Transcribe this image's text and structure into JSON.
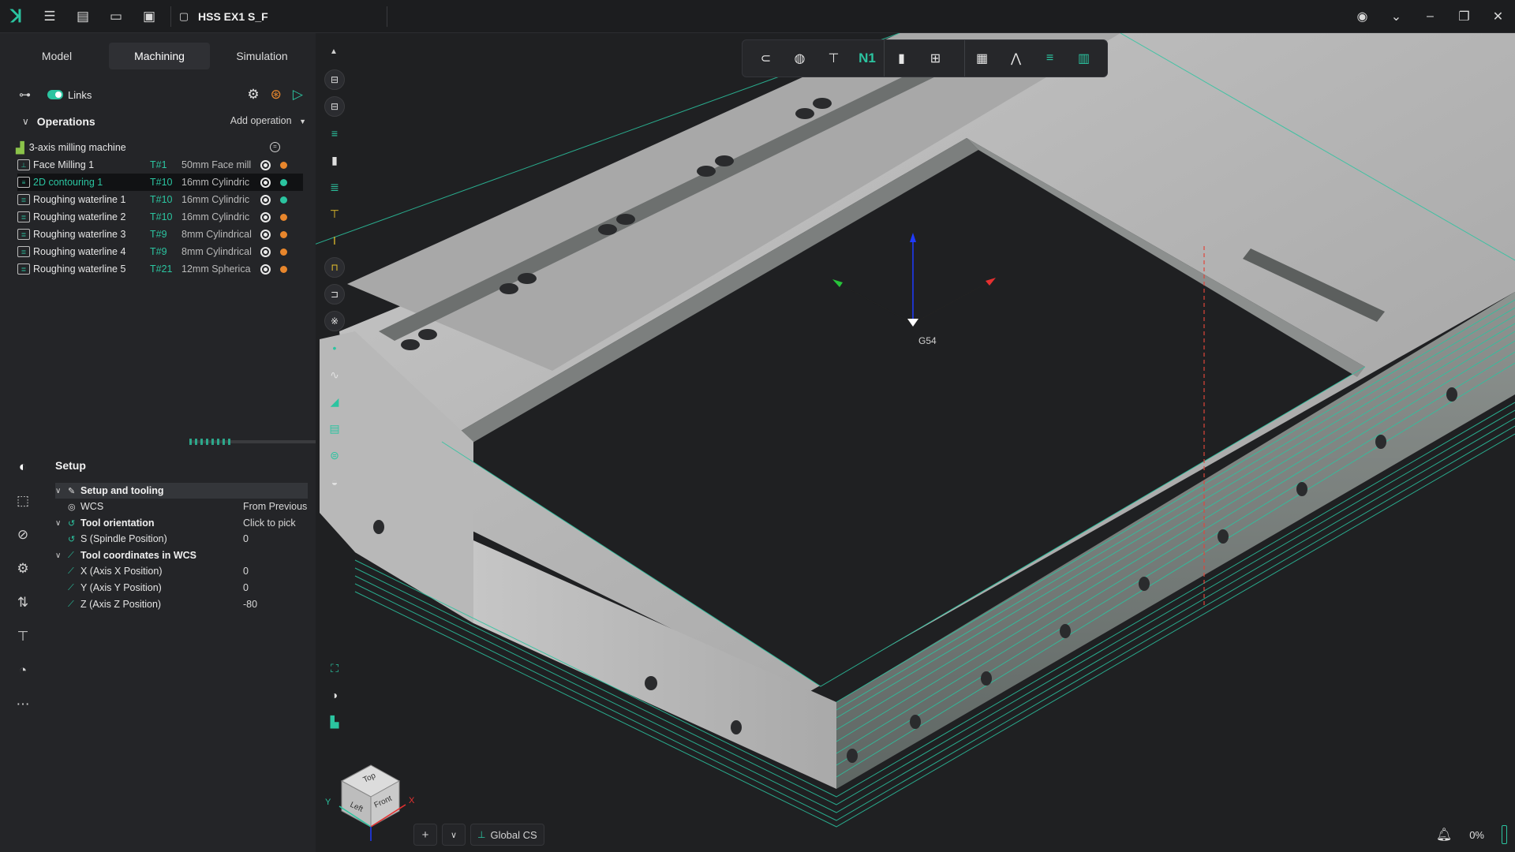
{
  "titlebar": {
    "doc_title": "HSS EX1 S_F",
    "icons": [
      "app-logo-icon",
      "menu-icon",
      "new-file-icon",
      "open-folder-icon",
      "save-icon",
      "document-icon"
    ],
    "right_icons": [
      "user-avatar-icon",
      "chevron-down-icon",
      "minimize-icon",
      "maximize-icon",
      "close-icon"
    ]
  },
  "tabs": [
    {
      "label": "Model"
    },
    {
      "label": "Machining"
    },
    {
      "label": "Simulation"
    }
  ],
  "links": {
    "label": "Links",
    "enabled": true
  },
  "operations": {
    "title": "Operations",
    "add_label": "Add operation",
    "machine": "3-axis milling machine",
    "items": [
      {
        "name": "Face Milling 1",
        "tool": "T#1",
        "desc": "50mm Face mill",
        "status": "#e8862c"
      },
      {
        "name": "2D contouring 1",
        "tool": "T#10",
        "desc": "16mm Cylindric",
        "status": "#2bc4a0"
      },
      {
        "name": "Roughing waterline 1",
        "tool": "T#10",
        "desc": "16mm Cylindric",
        "status": "#2bc4a0"
      },
      {
        "name": "Roughing waterline 2",
        "tool": "T#10",
        "desc": "16mm Cylindric",
        "status": "#e8862c"
      },
      {
        "name": "Roughing waterline 3",
        "tool": "T#9",
        "desc": "8mm Cylindrical",
        "status": "#e8862c"
      },
      {
        "name": "Roughing waterline 4",
        "tool": "T#9",
        "desc": "8mm Cylindrical",
        "status": "#e8862c"
      },
      {
        "name": "Roughing waterline 5",
        "tool": "T#21",
        "desc": "12mm Spherica",
        "status": "#e8862c"
      }
    ],
    "selected_index": 1
  },
  "setup": {
    "title": "Setup",
    "group1": "Setup and tooling",
    "wcs_label": "WCS",
    "wcs_value": "From Previous",
    "group2": "Tool orientation",
    "group2_value": "Click to pick",
    "spindle_label": "S (Spindle Position)",
    "spindle_value": "0",
    "group3": "Tool coordinates in WCS",
    "x_label": "X (Axis X Position)",
    "x_value": "0",
    "y_label": "Y (Axis Y Position)",
    "y_value": "0",
    "z_label": "Z (Axis Z Position)",
    "z_value": "-80"
  },
  "viewport": {
    "wcs_label": "G54",
    "cube": {
      "top": "Top",
      "left": "Left",
      "front": "Front",
      "x": "X",
      "y": "Y"
    },
    "n1_label": "N1",
    "coord_system": "Global CS",
    "progress": "0%"
  },
  "colors": {
    "accent": "#2bc4a0",
    "warning": "#e8862c",
    "background": "#1f2022"
  }
}
